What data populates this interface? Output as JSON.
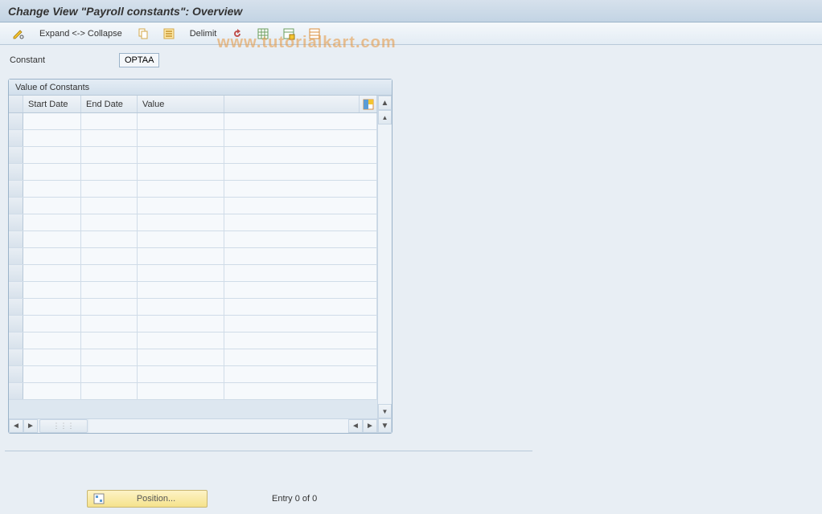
{
  "title": "Change View \"Payroll constants\": Overview",
  "toolbar": {
    "expand_collapse": "Expand <-> Collapse",
    "delimit": "Delimit"
  },
  "field": {
    "constant_label": "Constant",
    "constant_value": "OPTAA"
  },
  "panel": {
    "title": "Value of Constants",
    "columns": {
      "start_date": "Start Date",
      "end_date": "End Date",
      "value": "Value"
    }
  },
  "footer": {
    "position": "Position...",
    "entry": "Entry 0 of 0"
  },
  "watermark": "www.tutorialkart.com"
}
